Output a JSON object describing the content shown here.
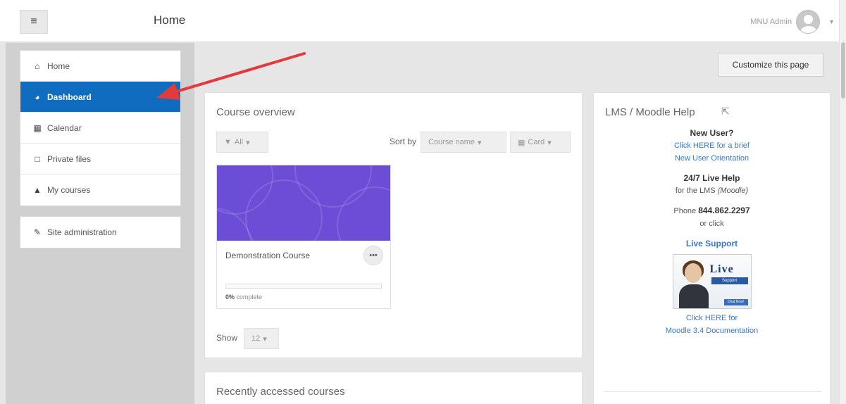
{
  "header": {
    "menu_icon": "hamburger-icon",
    "title": "Home",
    "user_name": "MNU Admin",
    "avatar_icon": "user-avatar-icon",
    "caret_icon": "caret-down-icon"
  },
  "sidebar": {
    "items": [
      {
        "label": "Home",
        "icon": "home-icon",
        "active": false
      },
      {
        "label": "Dashboard",
        "icon": "dashboard-icon",
        "active": true
      },
      {
        "label": "Calendar",
        "icon": "calendar-icon",
        "active": false
      },
      {
        "label": "Private files",
        "icon": "file-icon",
        "active": false
      },
      {
        "label": "My courses",
        "icon": "graduation-cap-icon",
        "active": false
      }
    ],
    "admin": {
      "label": "Site administration",
      "icon": "wrench-icon"
    }
  },
  "main": {
    "customize_label": "Customize this page",
    "overview": {
      "title": "Course overview",
      "filter_label": "All",
      "sort_by_label": "Sort by",
      "sort_value": "Course name",
      "view_value": "Card",
      "course": {
        "name": "Demonstration Course",
        "progress_percent": 0,
        "progress_value": "0%",
        "progress_suffix": "complete",
        "image_color": "#6c4ed6"
      },
      "show_label": "Show",
      "show_value": "12"
    },
    "recent": {
      "title": "Recently accessed courses"
    }
  },
  "help": {
    "title": "LMS / Moodle Help",
    "new_user": "New User?",
    "new_user_link_1": "Click HERE for a brief",
    "new_user_link_2": "New User Orientation",
    "live_help": "24/7 Live Help",
    "live_help_sub_1": "for the LMS ",
    "live_help_sub_2": "(Moodle)",
    "phone_label": "Phone ",
    "phone_number": "844.862.2297",
    "or_click": "or click",
    "live_support": "Live Support",
    "banner_text": "Live",
    "banner_sub": "Support",
    "banner_button": "Chat Now!",
    "doc_link_1": "Click HERE for",
    "doc_link_2": "Moodle 3.4 Documentation"
  },
  "colors": {
    "accent": "#0f6cbf",
    "annotation_arrow": "#e23b3b",
    "link": "#3a78c9"
  }
}
